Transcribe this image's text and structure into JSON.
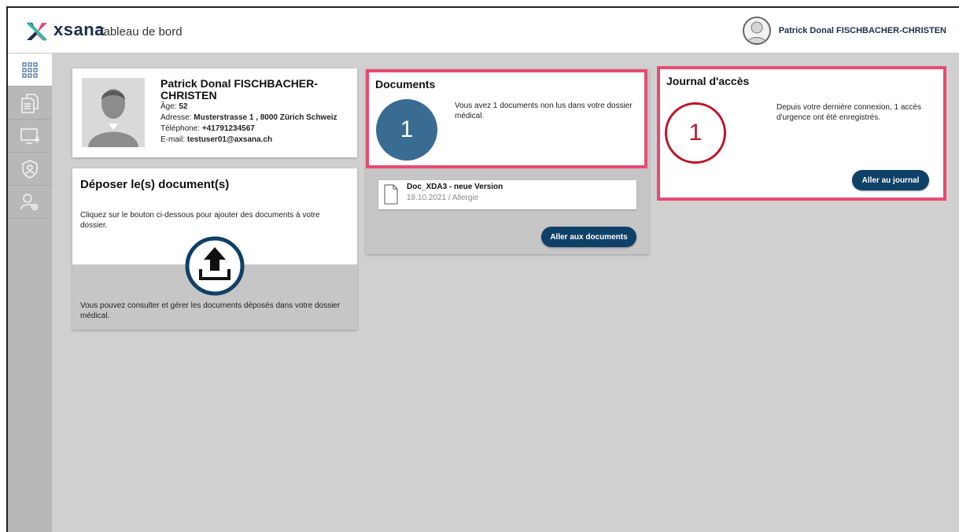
{
  "header": {
    "brand": "xsana",
    "title": "Tableau de bord",
    "user_name": "Patrick Donal FISCHBACHER-CHRISTEN"
  },
  "sidebar": {
    "items": [
      {
        "name": "dashboard",
        "icon": "grid-icon",
        "active": true
      },
      {
        "name": "documents",
        "icon": "documents-icon",
        "active": false
      },
      {
        "name": "devices",
        "icon": "monitor-icon",
        "active": false
      },
      {
        "name": "security",
        "icon": "shield-user-icon",
        "active": false
      },
      {
        "name": "settings",
        "icon": "user-gear-icon",
        "active": false
      }
    ]
  },
  "profile": {
    "name": "Patrick Donal FISCHBACHER-CHRISTEN",
    "age_label": "Âge:",
    "age": "52",
    "address_label": "Adresse:",
    "address": "Musterstrasse 1 , 8000 Zürich Schweiz",
    "phone_label": "Téléphone:",
    "phone": "+41791234567",
    "email_label": "E-mail:",
    "email": "testuser01@axsana.ch"
  },
  "upload": {
    "title": "Déposer le(s) document(s)",
    "description": "Cliquez sur le bouton ci-dessous pour ajouter des documents à votre dossier.",
    "footer": "Vous pouvez consulter et gérer les documents déposés dans votre dossier médical."
  },
  "documents": {
    "title": "Documents",
    "count": "1",
    "message": "Vous avez 1 documents non lus dans votre dossier médical.",
    "items": [
      {
        "name": "Doc_XDA3 - neue Version",
        "meta": "18.10.2021 / Allergie"
      }
    ],
    "button_label": "Aller aux documents"
  },
  "journal": {
    "title": "Journal d'accès",
    "count": "1",
    "message": "Depuis votre dernière connexion, 1 accès d'urgence ont été enregistrés.",
    "button_label": "Aller au journal"
  },
  "colors": {
    "accent": "#0f4068",
    "highlight": "#e84a72",
    "docs_circle": "#3a6b93",
    "journal_circle": "#c0132b"
  }
}
